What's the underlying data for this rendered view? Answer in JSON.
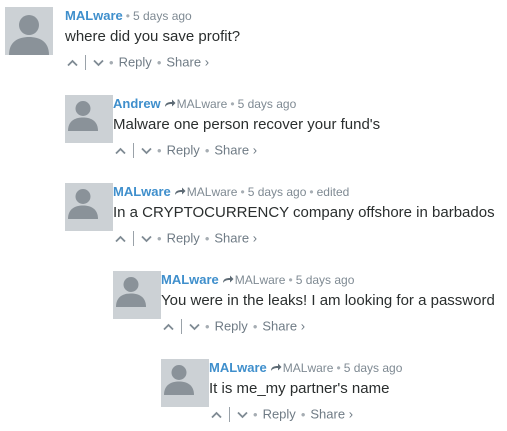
{
  "thread": {
    "comments": [
      {
        "author": "MALware",
        "parent_author": "",
        "time": "5 days ago",
        "edited": "",
        "text": "where did you save profit?",
        "reply_label": "Reply",
        "share_label": "Share",
        "share_chevron": "›"
      },
      {
        "author": "Andrew",
        "parent_author": "MALware",
        "time": "5 days ago",
        "edited": "",
        "text": "Malware one person recover your fund's",
        "reply_label": "Reply",
        "share_label": "Share",
        "share_chevron": "›"
      },
      {
        "author": "MALware",
        "parent_author": "MALware",
        "time": "5 days ago",
        "edited": "edited",
        "text": "In a CRYPTOCURRENCY company offshore in barbados",
        "reply_label": "Reply",
        "share_label": "Share",
        "share_chevron": "›"
      },
      {
        "author": "MALware",
        "parent_author": "MALware",
        "time": "5 days ago",
        "edited": "",
        "text": "You were in the leaks! I am looking for a password",
        "reply_label": "Reply",
        "share_label": "Share",
        "share_chevron": "›"
      },
      {
        "author": "MALware",
        "parent_author": "MALware",
        "time": "5 days ago",
        "edited": "",
        "text": "It is me_my partner's name",
        "reply_label": "Reply",
        "share_label": "Share",
        "share_chevron": "›"
      }
    ]
  },
  "icons": {
    "avatar": "default-avatar-icon",
    "reply_to": "reply-arrow-icon",
    "upvote": "chevron-up-icon",
    "downvote": "chevron-down-icon"
  },
  "colors": {
    "author": "#3f8fcc",
    "meta": "#7f8a93",
    "body": "#2a2e2e",
    "avatar_bg": "#ccd1d5",
    "avatar_fg": "#8a9299"
  }
}
